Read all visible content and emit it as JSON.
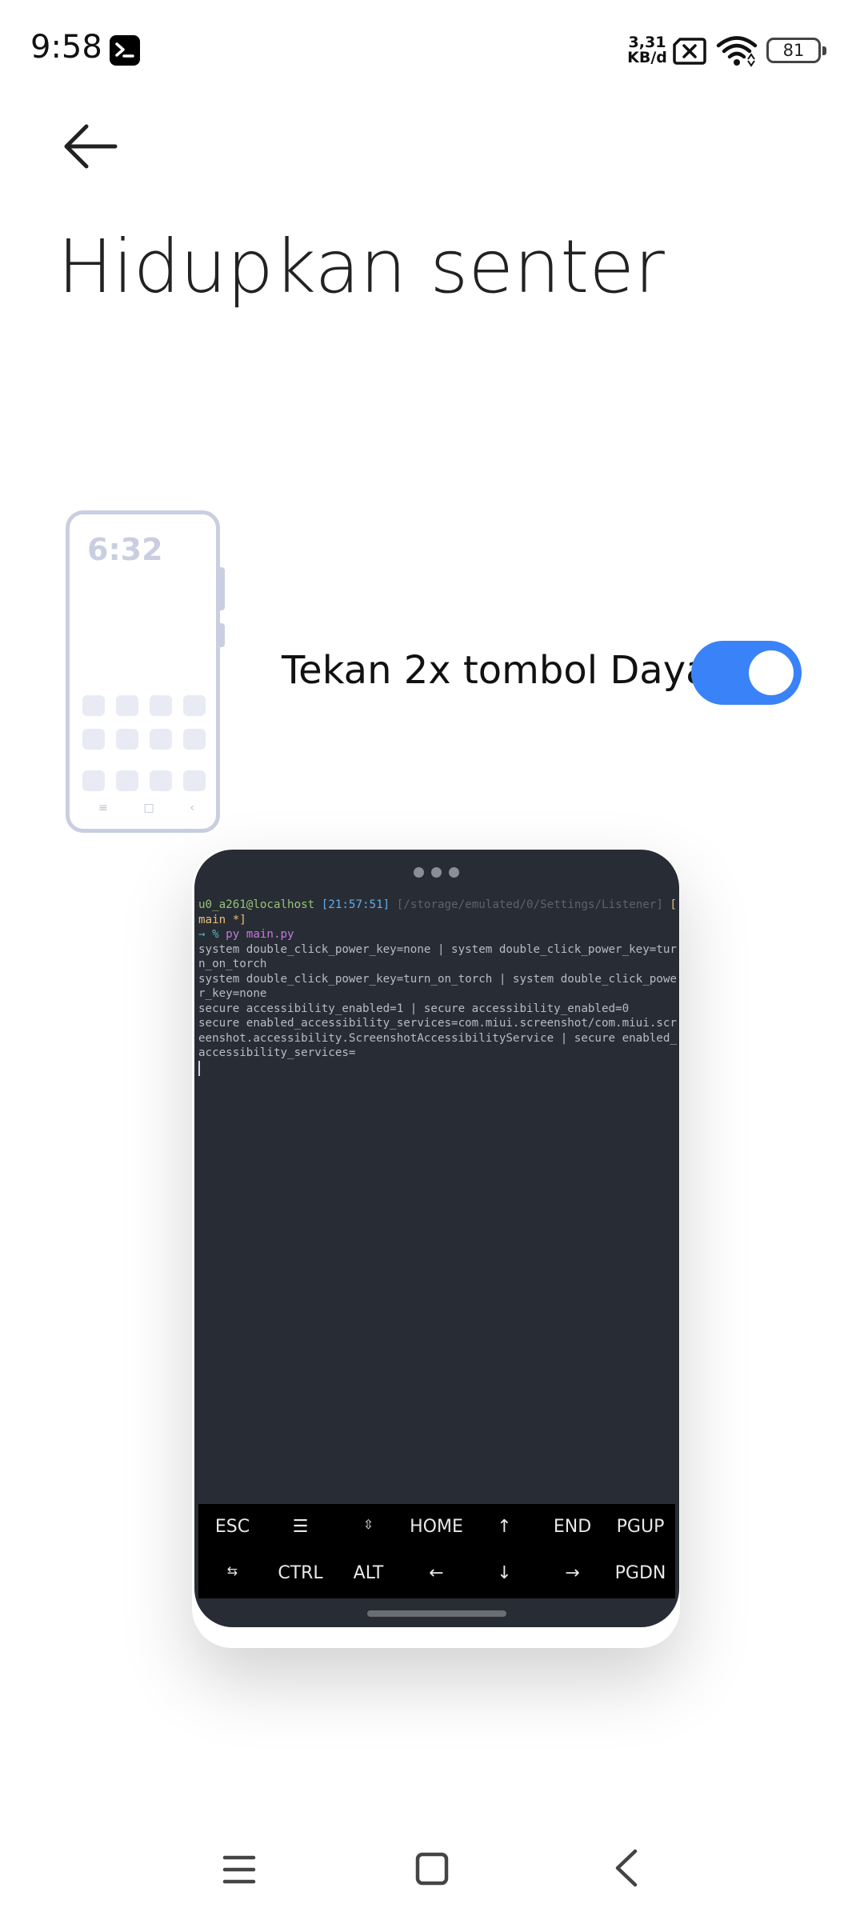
{
  "status_bar": {
    "time": "9:58",
    "netspeed_value": "3,31",
    "netspeed_unit": "KB/d",
    "battery": "81",
    "icons": [
      "terminal-app-icon",
      "no-sim-icon",
      "wifi-icon",
      "battery-icon"
    ]
  },
  "header": {
    "back_icon": "arrow-left-icon",
    "title": "Hidupkan senter"
  },
  "illustration": {
    "clock": "6:32",
    "nav_glyphs": [
      "≡",
      "□",
      "‹"
    ]
  },
  "setting": {
    "label": "Tekan 2x tombol Daya",
    "enabled": true,
    "accent_color": "#3a82f7"
  },
  "terminal": {
    "prompt_user": "u0_a261@localhost",
    "prompt_time": "[21:57:51]",
    "prompt_path": "[/storage/emulated/0/Settings/Listener]",
    "prompt_branch_open": " [",
    "prompt_branch": "main *]",
    "prompt_arrow": "→ %",
    "command": " py main.py",
    "output": [
      "system double_click_power_key=none | system double_click_power_key=tur",
      "n_on_torch",
      "system double_click_power_key=turn_on_torch | system double_click_powe",
      "r_key=none",
      "secure accessibility_enabled=1 | secure accessibility_enabled=0",
      "secure enabled_accessibility_services=com.miui.screenshot/com.miui.scr",
      "eenshot.accessibility.ScreenshotAccessibilityService | secure enabled_",
      "accessibility_services="
    ],
    "extra_keys_row1": [
      "ESC",
      "☰",
      "⇳",
      "HOME",
      "↑",
      "END",
      "PGUP"
    ],
    "extra_keys_row2": [
      "⇆",
      "CTRL",
      "ALT",
      "←",
      "↓",
      "→",
      "PGDN"
    ]
  },
  "nav_bar": {
    "icons": [
      "menu-icon",
      "home-square-icon",
      "back-chevron-icon"
    ]
  }
}
